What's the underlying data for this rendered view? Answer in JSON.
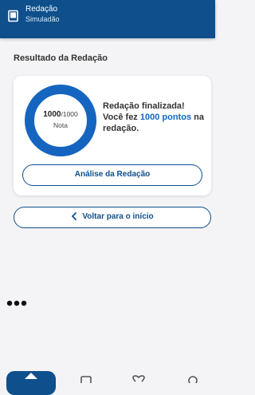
{
  "header": {
    "title": "Redação",
    "subtitle": "Simuladão",
    "icon": "book-icon"
  },
  "section_title": "Resultado da Redação",
  "result_card": {
    "score": "1000",
    "score_max": "/1000",
    "score_label": "Nota",
    "score_fraction": 1.0,
    "status_text": "Redação finalizada!",
    "points_prefix": "Você fez ",
    "points_highlight": "1000 pontos",
    "points_suffix": " na redação.",
    "analysis_button": "Análise da Redação"
  },
  "back_button": "Voltar para o início",
  "colors": {
    "primary": "#0e4f8c",
    "ring": "#1565c0",
    "highlight": "#1565c0",
    "background": "#f4f4f6"
  },
  "bottom_nav": {
    "items": [
      "home-icon",
      "book-icon",
      "heart-icon",
      "user-icon"
    ],
    "active_index": 0
  }
}
